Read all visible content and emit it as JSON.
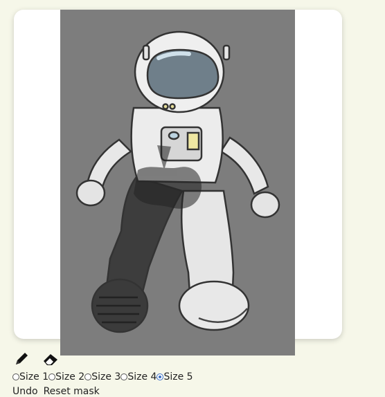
{
  "editor": {
    "image_subject": "astronaut-illustration",
    "mask_color": "#7d7d7d"
  },
  "toolbar": {
    "brush_icon": "pencil-icon",
    "eraser_icon": "eraser-icon"
  },
  "brush_sizes": {
    "options": [
      "Size 1",
      "Size 2",
      "Size 3",
      "Size 4",
      "Size 5"
    ],
    "selected": "Size 5"
  },
  "actions": {
    "undo_label": "Undo",
    "reset_label": "Reset mask"
  }
}
